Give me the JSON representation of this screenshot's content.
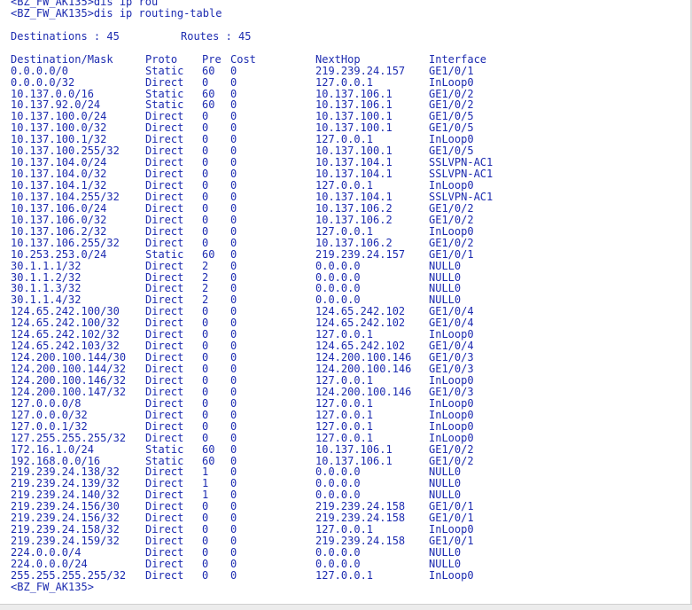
{
  "colors": {
    "text": "#1c2bb0",
    "background": "#ffffff"
  },
  "terminal": {
    "prev_prompt": "<BZ_FW_AK135>dis ip rou",
    "command_prompt": "<BZ_FW_AK135>dis ip routing-table",
    "summary": {
      "destinations_label": "Destinations : 45",
      "routes_label": "Routes : 45"
    },
    "headers": {
      "dest": "Destination/Mask",
      "proto": "Proto",
      "pre": "Pre",
      "cost": "Cost",
      "nexthop": "NextHop",
      "iface": "Interface"
    },
    "routes": [
      {
        "dest": "0.0.0.0/0",
        "proto": "Static",
        "pre": "60",
        "cost": "0",
        "nexthop": "219.239.24.157",
        "iface": "GE1/0/1"
      },
      {
        "dest": "0.0.0.0/32",
        "proto": "Direct",
        "pre": "0",
        "cost": "0",
        "nexthop": "127.0.0.1",
        "iface": "InLoop0"
      },
      {
        "dest": "10.137.0.0/16",
        "proto": "Static",
        "pre": "60",
        "cost": "0",
        "nexthop": "10.137.106.1",
        "iface": "GE1/0/2"
      },
      {
        "dest": "10.137.92.0/24",
        "proto": "Static",
        "pre": "60",
        "cost": "0",
        "nexthop": "10.137.106.1",
        "iface": "GE1/0/2"
      },
      {
        "dest": "10.137.100.0/24",
        "proto": "Direct",
        "pre": "0",
        "cost": "0",
        "nexthop": "10.137.100.1",
        "iface": "GE1/0/5"
      },
      {
        "dest": "10.137.100.0/32",
        "proto": "Direct",
        "pre": "0",
        "cost": "0",
        "nexthop": "10.137.100.1",
        "iface": "GE1/0/5"
      },
      {
        "dest": "10.137.100.1/32",
        "proto": "Direct",
        "pre": "0",
        "cost": "0",
        "nexthop": "127.0.0.1",
        "iface": "InLoop0"
      },
      {
        "dest": "10.137.100.255/32",
        "proto": "Direct",
        "pre": "0",
        "cost": "0",
        "nexthop": "10.137.100.1",
        "iface": "GE1/0/5"
      },
      {
        "dest": "10.137.104.0/24",
        "proto": "Direct",
        "pre": "0",
        "cost": "0",
        "nexthop": "10.137.104.1",
        "iface": "SSLVPN-AC1"
      },
      {
        "dest": "10.137.104.0/32",
        "proto": "Direct",
        "pre": "0",
        "cost": "0",
        "nexthop": "10.137.104.1",
        "iface": "SSLVPN-AC1"
      },
      {
        "dest": "10.137.104.1/32",
        "proto": "Direct",
        "pre": "0",
        "cost": "0",
        "nexthop": "127.0.0.1",
        "iface": "InLoop0"
      },
      {
        "dest": "10.137.104.255/32",
        "proto": "Direct",
        "pre": "0",
        "cost": "0",
        "nexthop": "10.137.104.1",
        "iface": "SSLVPN-AC1"
      },
      {
        "dest": "10.137.106.0/24",
        "proto": "Direct",
        "pre": "0",
        "cost": "0",
        "nexthop": "10.137.106.2",
        "iface": "GE1/0/2"
      },
      {
        "dest": "10.137.106.0/32",
        "proto": "Direct",
        "pre": "0",
        "cost": "0",
        "nexthop": "10.137.106.2",
        "iface": "GE1/0/2"
      },
      {
        "dest": "10.137.106.2/32",
        "proto": "Direct",
        "pre": "0",
        "cost": "0",
        "nexthop": "127.0.0.1",
        "iface": "InLoop0"
      },
      {
        "dest": "10.137.106.255/32",
        "proto": "Direct",
        "pre": "0",
        "cost": "0",
        "nexthop": "10.137.106.2",
        "iface": "GE1/0/2"
      },
      {
        "dest": "10.253.253.0/24",
        "proto": "Static",
        "pre": "60",
        "cost": "0",
        "nexthop": "219.239.24.157",
        "iface": "GE1/0/1"
      },
      {
        "dest": "30.1.1.1/32",
        "proto": "Direct",
        "pre": "2",
        "cost": "0",
        "nexthop": "0.0.0.0",
        "iface": "NULL0"
      },
      {
        "dest": "30.1.1.2/32",
        "proto": "Direct",
        "pre": "2",
        "cost": "0",
        "nexthop": "0.0.0.0",
        "iface": "NULL0"
      },
      {
        "dest": "30.1.1.3/32",
        "proto": "Direct",
        "pre": "2",
        "cost": "0",
        "nexthop": "0.0.0.0",
        "iface": "NULL0"
      },
      {
        "dest": "30.1.1.4/32",
        "proto": "Direct",
        "pre": "2",
        "cost": "0",
        "nexthop": "0.0.0.0",
        "iface": "NULL0"
      },
      {
        "dest": "124.65.242.100/30",
        "proto": "Direct",
        "pre": "0",
        "cost": "0",
        "nexthop": "124.65.242.102",
        "iface": "GE1/0/4"
      },
      {
        "dest": "124.65.242.100/32",
        "proto": "Direct",
        "pre": "0",
        "cost": "0",
        "nexthop": "124.65.242.102",
        "iface": "GE1/0/4"
      },
      {
        "dest": "124.65.242.102/32",
        "proto": "Direct",
        "pre": "0",
        "cost": "0",
        "nexthop": "127.0.0.1",
        "iface": "InLoop0"
      },
      {
        "dest": "124.65.242.103/32",
        "proto": "Direct",
        "pre": "0",
        "cost": "0",
        "nexthop": "124.65.242.102",
        "iface": "GE1/0/4"
      },
      {
        "dest": "124.200.100.144/30",
        "proto": "Direct",
        "pre": "0",
        "cost": "0",
        "nexthop": "124.200.100.146",
        "iface": "GE1/0/3"
      },
      {
        "dest": "124.200.100.144/32",
        "proto": "Direct",
        "pre": "0",
        "cost": "0",
        "nexthop": "124.200.100.146",
        "iface": "GE1/0/3"
      },
      {
        "dest": "124.200.100.146/32",
        "proto": "Direct",
        "pre": "0",
        "cost": "0",
        "nexthop": "127.0.0.1",
        "iface": "InLoop0"
      },
      {
        "dest": "124.200.100.147/32",
        "proto": "Direct",
        "pre": "0",
        "cost": "0",
        "nexthop": "124.200.100.146",
        "iface": "GE1/0/3"
      },
      {
        "dest": "127.0.0.0/8",
        "proto": "Direct",
        "pre": "0",
        "cost": "0",
        "nexthop": "127.0.0.1",
        "iface": "InLoop0"
      },
      {
        "dest": "127.0.0.0/32",
        "proto": "Direct",
        "pre": "0",
        "cost": "0",
        "nexthop": "127.0.0.1",
        "iface": "InLoop0"
      },
      {
        "dest": "127.0.0.1/32",
        "proto": "Direct",
        "pre": "0",
        "cost": "0",
        "nexthop": "127.0.0.1",
        "iface": "InLoop0"
      },
      {
        "dest": "127.255.255.255/32",
        "proto": "Direct",
        "pre": "0",
        "cost": "0",
        "nexthop": "127.0.0.1",
        "iface": "InLoop0"
      },
      {
        "dest": "172.16.1.0/24",
        "proto": "Static",
        "pre": "60",
        "cost": "0",
        "nexthop": "10.137.106.1",
        "iface": "GE1/0/2"
      },
      {
        "dest": "192.168.0.0/16",
        "proto": "Static",
        "pre": "60",
        "cost": "0",
        "nexthop": "10.137.106.1",
        "iface": "GE1/0/2"
      },
      {
        "dest": "219.239.24.138/32",
        "proto": "Direct",
        "pre": "1",
        "cost": "0",
        "nexthop": "0.0.0.0",
        "iface": "NULL0"
      },
      {
        "dest": "219.239.24.139/32",
        "proto": "Direct",
        "pre": "1",
        "cost": "0",
        "nexthop": "0.0.0.0",
        "iface": "NULL0"
      },
      {
        "dest": "219.239.24.140/32",
        "proto": "Direct",
        "pre": "1",
        "cost": "0",
        "nexthop": "0.0.0.0",
        "iface": "NULL0"
      },
      {
        "dest": "219.239.24.156/30",
        "proto": "Direct",
        "pre": "0",
        "cost": "0",
        "nexthop": "219.239.24.158",
        "iface": "GE1/0/1"
      },
      {
        "dest": "219.239.24.156/32",
        "proto": "Direct",
        "pre": "0",
        "cost": "0",
        "nexthop": "219.239.24.158",
        "iface": "GE1/0/1"
      },
      {
        "dest": "219.239.24.158/32",
        "proto": "Direct",
        "pre": "0",
        "cost": "0",
        "nexthop": "127.0.0.1",
        "iface": "InLoop0"
      },
      {
        "dest": "219.239.24.159/32",
        "proto": "Direct",
        "pre": "0",
        "cost": "0",
        "nexthop": "219.239.24.158",
        "iface": "GE1/0/1"
      },
      {
        "dest": "224.0.0.0/4",
        "proto": "Direct",
        "pre": "0",
        "cost": "0",
        "nexthop": "0.0.0.0",
        "iface": "NULL0"
      },
      {
        "dest": "224.0.0.0/24",
        "proto": "Direct",
        "pre": "0",
        "cost": "0",
        "nexthop": "0.0.0.0",
        "iface": "NULL0"
      },
      {
        "dest": "255.255.255.255/32",
        "proto": "Direct",
        "pre": "0",
        "cost": "0",
        "nexthop": "127.0.0.1",
        "iface": "InLoop0"
      }
    ],
    "end_prompt": "<BZ_FW_AK135>"
  }
}
